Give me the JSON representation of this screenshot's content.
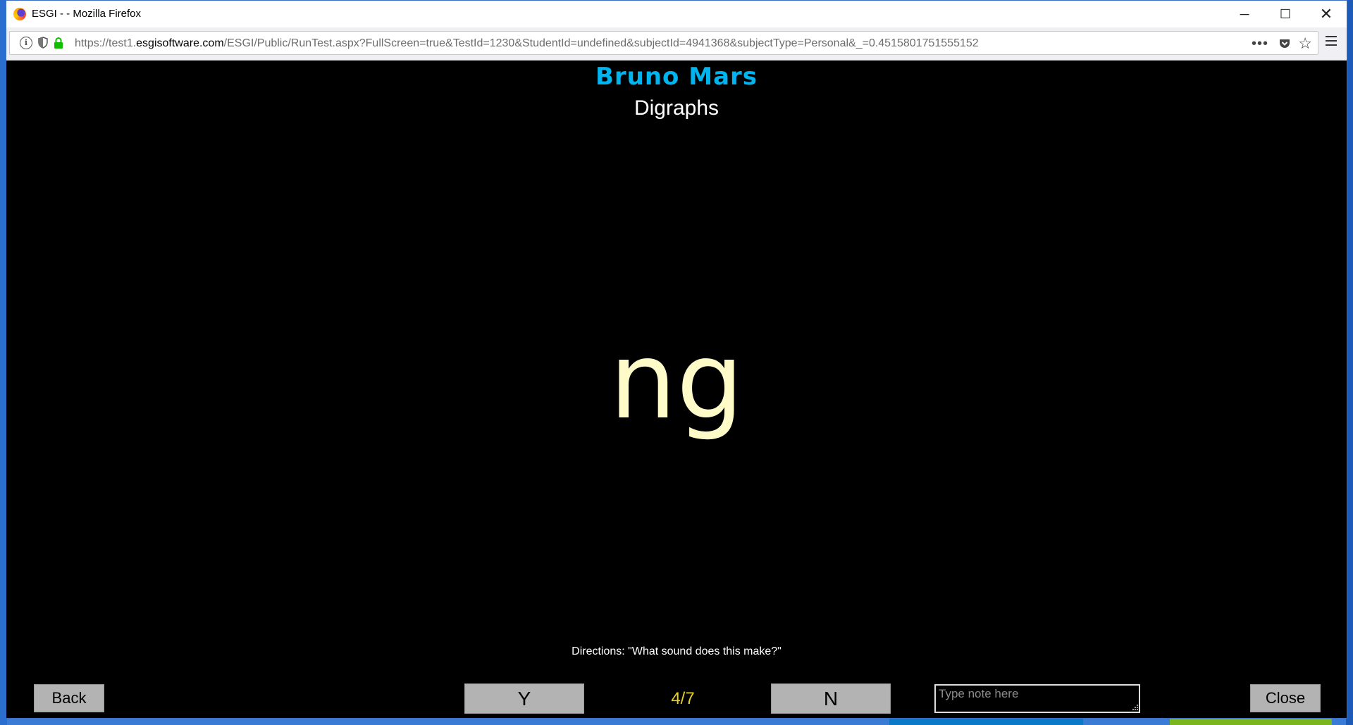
{
  "window": {
    "title": "ESGI - - Mozilla Firefox",
    "min_symbol": "─",
    "max_symbol": "☐",
    "close_symbol": "✕"
  },
  "navbar": {
    "url_prefix": "https://test1.",
    "url_host": "esgisoftware.com",
    "url_rest": "/ESGI/Public/RunTest.aspx?FullScreen=true&TestId=1230&StudentId=undefined&subjectId=4941368&subjectType=Personal&_=0.4515801751555152",
    "info_symbol": "i",
    "dots_symbol": "•••",
    "star_symbol": "☆"
  },
  "test": {
    "student_name": "Bruno Mars",
    "subject_name": "Digraphs",
    "question": "ng",
    "directions": "Directions: \"What sound does this make?\"",
    "counter": "4/7"
  },
  "controls": {
    "back_label": "Back",
    "yes_label": "Y",
    "no_label": "N",
    "close_label": "Close",
    "note_placeholder": "Type note here"
  },
  "colors": {
    "student_name": "#00b4f0",
    "question": "#fffbc8",
    "counter": "#e6d321",
    "button_bg": "#b3b3b3"
  }
}
